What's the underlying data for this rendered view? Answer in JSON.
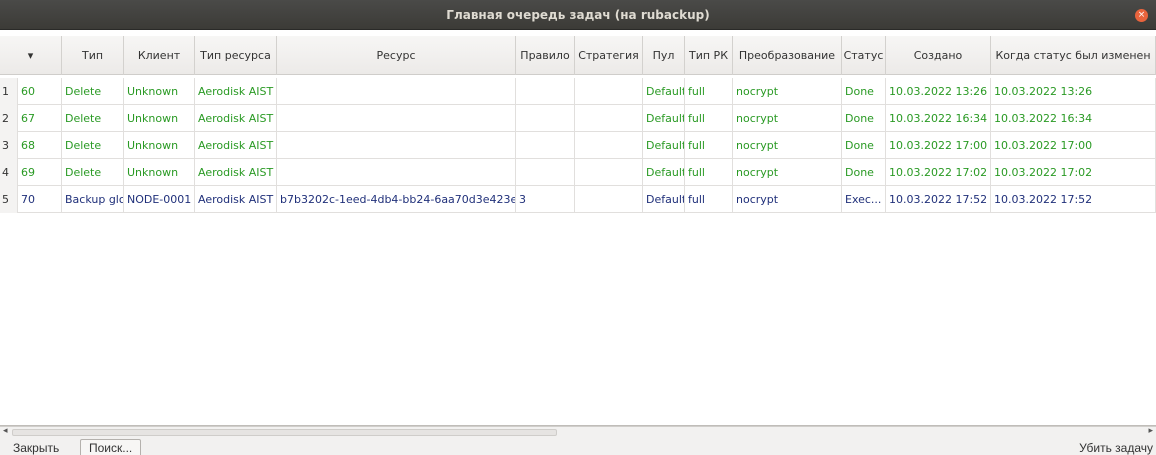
{
  "window": {
    "title": "Главная очередь задач (на rubackup)",
    "close_glyph": "×"
  },
  "table": {
    "sort_glyph": "▾",
    "columns": [
      "",
      "Тип",
      "Клиент",
      "Тип ресурса",
      "Ресурс",
      "Правило",
      "Стратегия",
      "Пул",
      "Тип РК",
      "Преобразование",
      "Статус",
      "Создано",
      "Когда статус был изменен"
    ],
    "rows": [
      {
        "num": "1",
        "id": "60",
        "type": "Delete",
        "client": "Unknown",
        "res_type": "Aerodisk AIST",
        "resource": "",
        "rule": "",
        "strategy": "",
        "pool": "Default",
        "rk": "full",
        "conv": "nocrypt",
        "status": "Done",
        "created": "10.03.2022 13:26",
        "changed": "10.03.2022 13:26",
        "color": "green"
      },
      {
        "num": "2",
        "id": "67",
        "type": "Delete",
        "client": "Unknown",
        "res_type": "Aerodisk AIST",
        "resource": "",
        "rule": "",
        "strategy": "",
        "pool": "Default",
        "rk": "full",
        "conv": "nocrypt",
        "status": "Done",
        "created": "10.03.2022 16:34",
        "changed": "10.03.2022 16:34",
        "color": "green"
      },
      {
        "num": "3",
        "id": "68",
        "type": "Delete",
        "client": "Unknown",
        "res_type": "Aerodisk AIST",
        "resource": "",
        "rule": "",
        "strategy": "",
        "pool": "Default",
        "rk": "full",
        "conv": "nocrypt",
        "status": "Done",
        "created": "10.03.2022 17:00",
        "changed": "10.03.2022 17:00",
        "color": "green"
      },
      {
        "num": "4",
        "id": "69",
        "type": "Delete",
        "client": "Unknown",
        "res_type": "Aerodisk AIST",
        "resource": "",
        "rule": "",
        "strategy": "",
        "pool": "Default",
        "rk": "full",
        "conv": "nocrypt",
        "status": "Done",
        "created": "10.03.2022 17:02",
        "changed": "10.03.2022 17:02",
        "color": "green"
      },
      {
        "num": "5",
        "id": "70",
        "type": "Backup global",
        "client": "NODE-0001",
        "res_type": "Aerodisk AIST",
        "resource": "b7b3202c-1eed-4db4-bb24-6aa70d3e423e",
        "rule": "3",
        "strategy": "",
        "pool": "Default",
        "rk": "full",
        "conv": "nocrypt",
        "status": "Exec...",
        "created": "10.03.2022 17:52",
        "changed": "10.03.2022 17:52",
        "color": "blue"
      }
    ]
  },
  "colors": {
    "green": "#2a9a24",
    "blue": "#20307a"
  },
  "footer": {
    "close_label": "Закрыть",
    "search_label": "Поиск...",
    "kill_label": "Убить задачу"
  },
  "scroll": {
    "left_glyph": "◂",
    "right_glyph": "▸"
  }
}
